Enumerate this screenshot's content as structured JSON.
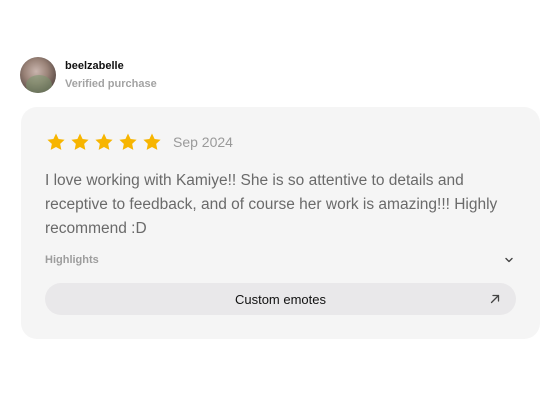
{
  "reviewer": {
    "name": "beelzabelle",
    "status": "Verified purchase",
    "avatar_icon": "user-avatar-photo"
  },
  "review": {
    "rating": 5,
    "rating_max": 5,
    "star_color": "#f7b500",
    "date": "Sep 2024",
    "text": "I love working with Kamiye!! She is so attentive to details and receptive to feedback, and of course her work is amazing!!! Highly recommend :D"
  },
  "highlights": {
    "label": "Highlights",
    "toggle_icon": "chevron-down-icon",
    "tags": [
      {
        "label": "Custom emotes",
        "icon": "arrow-up-right-icon"
      }
    ]
  },
  "colors": {
    "card_background": "#f5f5f5",
    "tag_background": "#e9e8ea"
  }
}
